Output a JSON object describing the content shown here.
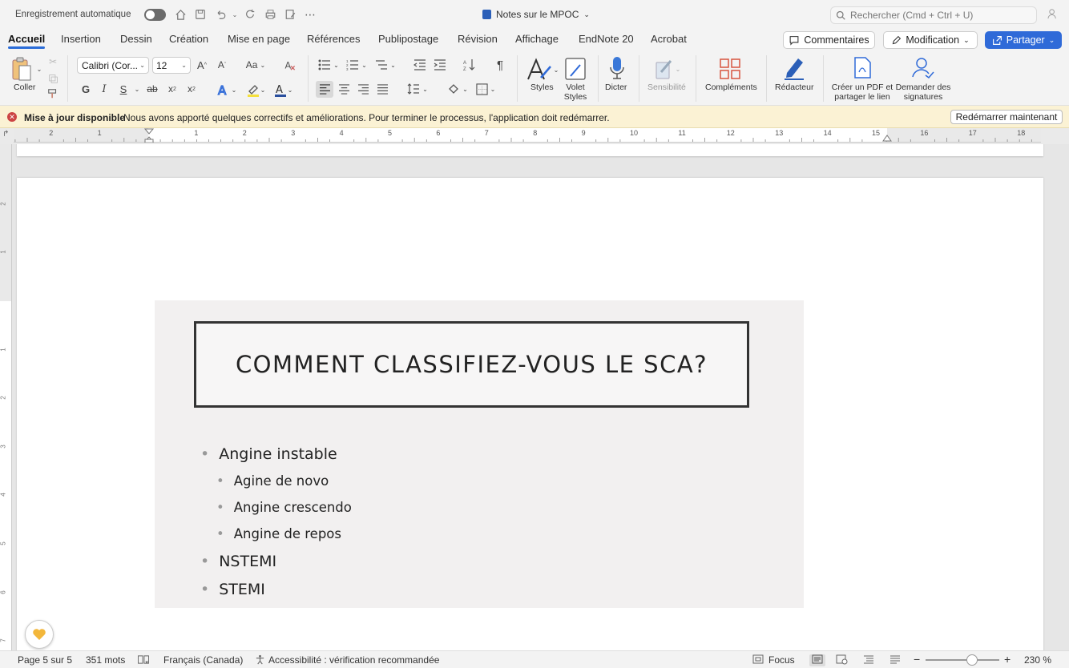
{
  "titlebar": {
    "autosave_label": "Enregistrement automatique",
    "doc_title": "Notes sur le MPOC",
    "search_placeholder": "Rechercher (Cmd + Ctrl + U)"
  },
  "tabs": [
    "Accueil",
    "Insertion",
    "Dessin",
    "Création",
    "Mise en page",
    "Références",
    "Publipostage",
    "Révision",
    "Affichage",
    "EndNote 20",
    "Acrobat"
  ],
  "actions": {
    "comments": "Commentaires",
    "edit": "Modification",
    "share": "Partager"
  },
  "ribbon": {
    "paste": "Coller",
    "font_name": "Calibri (Cor...",
    "font_size": "12",
    "bold": "G",
    "italic": "I",
    "underline": "S",
    "strike": "ab",
    "styles": "Styles",
    "styles_pane_1": "Volet",
    "styles_pane_2": "Styles",
    "dictate": "Dicter",
    "sensitivity": "Sensibilité",
    "addins": "Compléments",
    "editor": "Rédacteur",
    "pdf_1": "Créer un PDF et",
    "pdf_2": "partager le lien",
    "sign_1": "Demander des",
    "sign_2": "signatures"
  },
  "notification": {
    "title": "Mise à jour disponible",
    "message": "Nous avons apporté quelques correctifs et améliorations. Pour terminer le processus, l'application doit  redémarrer.",
    "button": "Redémarrer maintenant"
  },
  "ruler": {
    "numbers": [
      "2",
      "1",
      "1",
      "2",
      "3",
      "4",
      "5",
      "6",
      "7",
      "8",
      "9",
      "10",
      "11",
      "12",
      "13",
      "14",
      "15",
      "16",
      "17",
      "18"
    ],
    "vnumbers": [
      "2",
      "1",
      "1",
      "2",
      "3",
      "4",
      "5",
      "6",
      "7"
    ]
  },
  "slide": {
    "title": "COMMENT CLASSIFIEZ-VOUS LE SCA?",
    "bullets": [
      {
        "level": 1,
        "text": "Angine instable"
      },
      {
        "level": 2,
        "text": "Agine de novo"
      },
      {
        "level": 2,
        "text": "Angine crescendo"
      },
      {
        "level": 2,
        "text": "Angine de repos"
      },
      {
        "level": 1,
        "text": "NSTEMI"
      },
      {
        "level": 1,
        "text": "STEMI"
      }
    ]
  },
  "status": {
    "page": "Page 5 sur 5",
    "words": "351 mots",
    "language": "Français (Canada)",
    "accessibility": "Accessibilité : vérification recommandée",
    "focus": "Focus",
    "zoom": "230 %"
  },
  "colors": {
    "accent": "#2f6ad8",
    "notification_bg": "#fbf2d4"
  }
}
